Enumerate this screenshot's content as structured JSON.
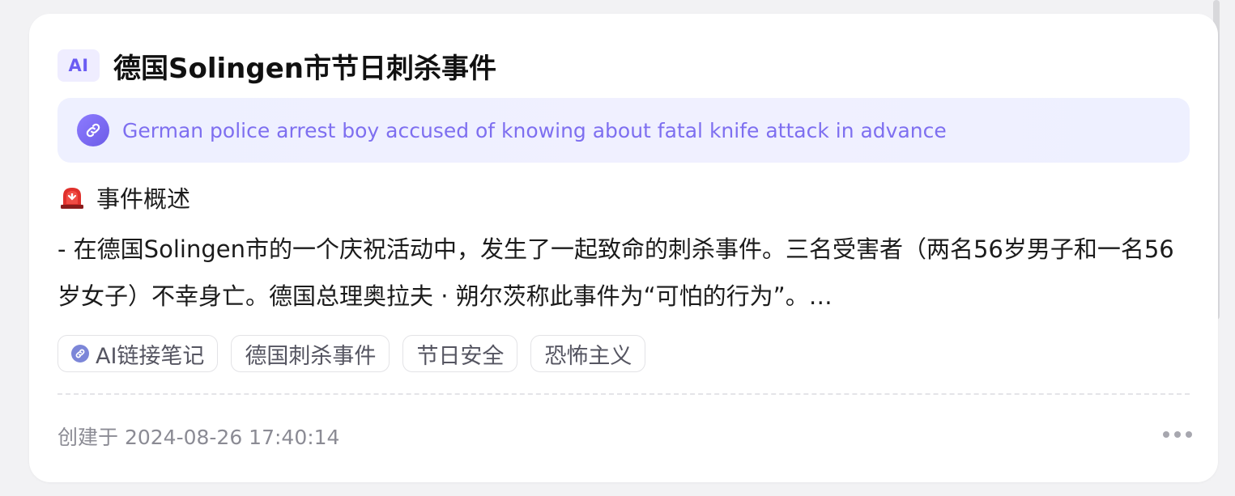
{
  "card": {
    "ai_badge": "AI",
    "title": "德国Solingen市节日刺杀事件",
    "source": {
      "icon": "link-icon",
      "text": "German police arrest boy accused of knowing about fatal knife attack in advance"
    },
    "section": {
      "icon": "siren-icon",
      "heading": "事件概述"
    },
    "summary": "- 在德国Solingen市的一个庆祝活动中，发生了一起致命的刺杀事件。三名受害者（两名56岁男子和一名56岁女子）不幸身亡。德国总理奥拉夫 · 朔尔茨称此事件为“可怕的行为”。…",
    "tags": [
      {
        "label": "AI链接笔记",
        "icon": "link-icon"
      },
      {
        "label": "德国刺杀事件"
      },
      {
        "label": "节日安全"
      },
      {
        "label": "恐怖主义"
      }
    ],
    "created": "创建于 2024-08-26 17:40:14",
    "more_icon": "more-dots-icon"
  },
  "colors": {
    "accent": "#6b5cf3",
    "source_bg": "#eef0ff",
    "tag_border": "#e3e3e6",
    "meta_text": "#8b8b94"
  }
}
